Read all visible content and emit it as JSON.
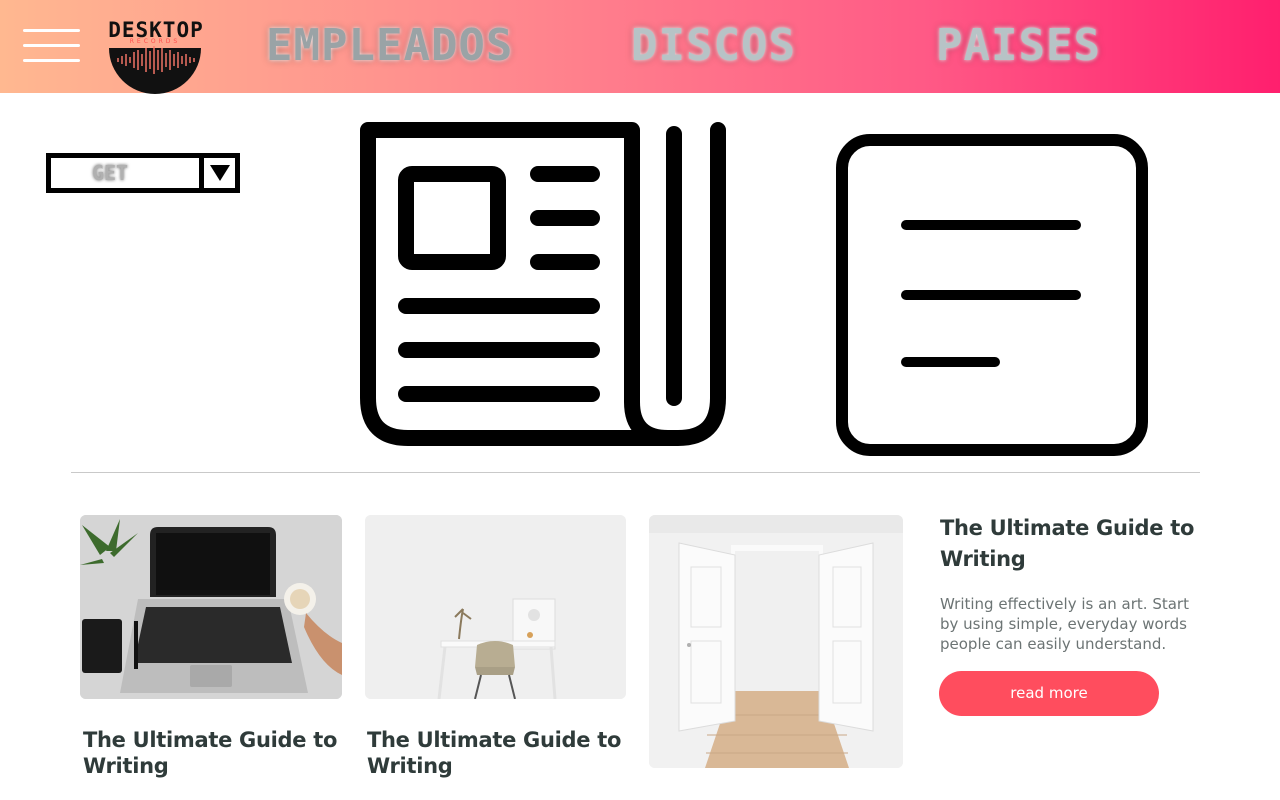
{
  "header": {
    "logo": {
      "title": "DESKTOP",
      "subtitle": "RECORDS"
    },
    "nav": [
      {
        "label": "EMPLEADOS"
      },
      {
        "label": "DISCOS"
      },
      {
        "label": "PAISES"
      }
    ]
  },
  "dropdown": {
    "selected": "GET"
  },
  "icons": {
    "menu": "menu-icon",
    "newspaper": "newspaper-icon",
    "notes": "notes-icon",
    "caret": "triangle-down-icon"
  },
  "cards": [
    {
      "title": "The Ultimate Guide to Writing",
      "image": "laptop-desk-photo"
    },
    {
      "title": "The Ultimate Guide to Writing",
      "image": "white-desk-chair-photo"
    }
  ],
  "feature": {
    "image": "open-white-doors-photo",
    "title": "The Ultimate Guide to Writing",
    "description": "Writing effectively is an art. Start by using simple, everyday words people can easily understand.",
    "button_label": "read more"
  },
  "colors": {
    "accent": "#ff4d5e",
    "header_start": "#ffb890",
    "header_end": "#ff1f6e",
    "heading_text": "#2f3b3a",
    "body_text": "#6c7474"
  }
}
